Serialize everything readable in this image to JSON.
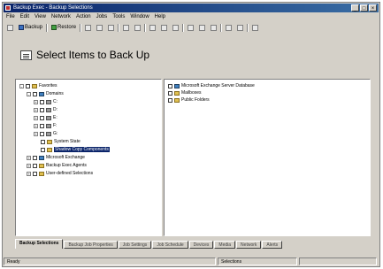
{
  "window": {
    "title": "Backup Exec - Backup Selections",
    "controls": [
      "_",
      "□",
      "×"
    ]
  },
  "menu": [
    "File",
    "Edit",
    "View",
    "Network",
    "Action",
    "Jobs",
    "Tools",
    "Window",
    "Help"
  ],
  "toolbar": {
    "backup_label": "Backup",
    "restore_label": "Restore"
  },
  "header": {
    "title": "Select Items to Back Up"
  },
  "tree": {
    "items": [
      {
        "label": "Favorites"
      },
      {
        "label": "Domains"
      },
      {
        "label": "C:"
      },
      {
        "label": "D:"
      },
      {
        "label": "E:"
      },
      {
        "label": "F:"
      },
      {
        "label": "G:"
      },
      {
        "label": "System State"
      },
      {
        "label": "Shadow Copy Components"
      },
      {
        "label": "Microsoft Exchange"
      },
      {
        "label": "Backup Exec Agents"
      },
      {
        "label": "User-defined Selections"
      }
    ]
  },
  "list": {
    "items": [
      {
        "label": "Microsoft Exchange Server Database"
      },
      {
        "label": "Mailboxes"
      },
      {
        "label": "Public Folders"
      }
    ]
  },
  "tabs": [
    "Backup Selections",
    "Backup Job Properties",
    "Job Settings",
    "Job Schedule",
    "Devices",
    "Media",
    "Network",
    "Alerts"
  ],
  "status": {
    "left": "Ready",
    "middle": "Selections"
  },
  "colors": {
    "titlebar_start": "#0a246a",
    "titlebar_end": "#3a6ea5",
    "chrome": "#d4d0c8",
    "selection": "#0a246a"
  }
}
